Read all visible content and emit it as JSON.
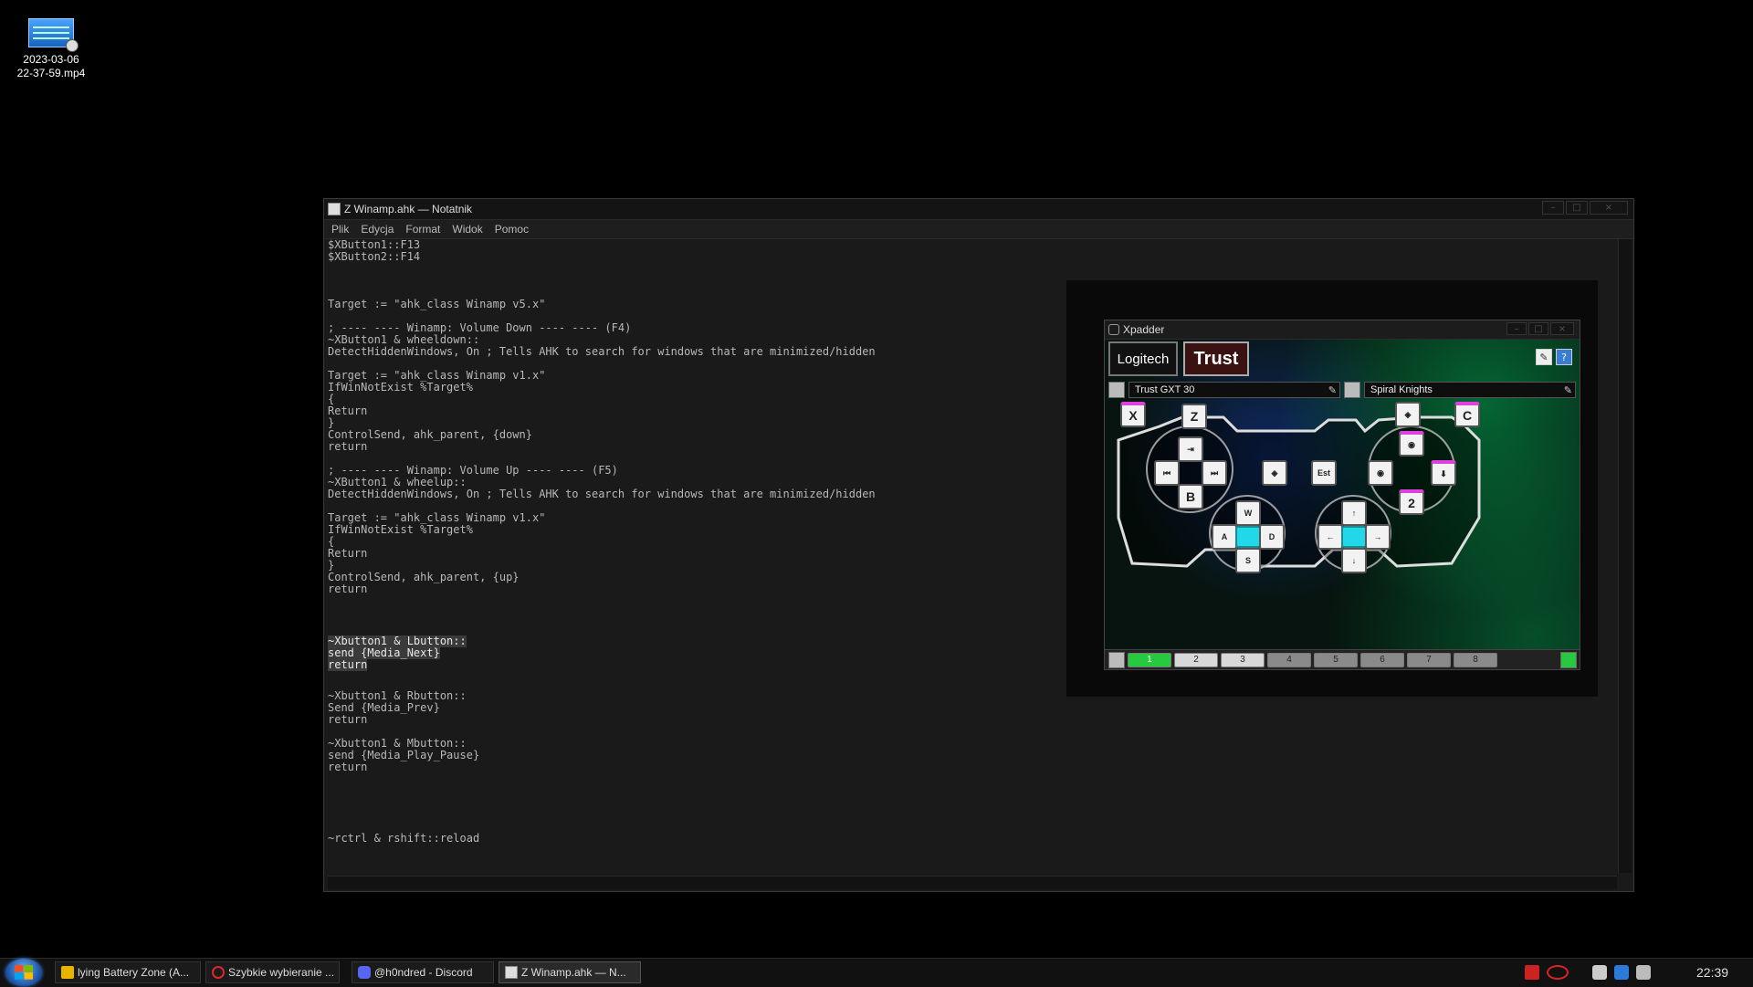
{
  "desktop": {
    "icons": [
      {
        "label_line1": "2023-03-06",
        "label_line2": "22-37-59.mp4",
        "icon": "video-file-icon"
      }
    ]
  },
  "notepad": {
    "title": "Z Winamp.ahk — Notatnik",
    "menu": [
      "Plik",
      "Edycja",
      "Format",
      "Widok",
      "Pomoc"
    ],
    "lines": [
      "$XButton1::F13",
      "$XButton2::F14",
      "",
      "",
      "",
      "Target := \"ahk_class Winamp v5.x\"",
      "",
      "; ---- ---- Winamp: Volume Down ---- ---- (F4)",
      "~XButton1 & wheeldown::",
      "DetectHiddenWindows, On ; Tells AHK to search for windows that are minimized/hidden",
      "",
      "Target := \"ahk_class Winamp v1.x\"",
      "IfWinNotExist %Target%",
      "{",
      "Return",
      "}",
      "ControlSend, ahk_parent, {down}",
      "return",
      "",
      "; ---- ---- Winamp: Volume Up ---- ---- (F5)",
      "~XButton1 & wheelup::",
      "DetectHiddenWindows, On ; Tells AHK to search for windows that are minimized/hidden",
      "",
      "Target := \"ahk_class Winamp v1.x\"",
      "IfWinNotExist %Target%",
      "{",
      "Return",
      "}",
      "ControlSend, ahk_parent, {up}",
      "return",
      "",
      "",
      "",
      "~Xbutton1 & Lbutton::",
      "send {Media_Next}",
      "return",
      "",
      "",
      "~Xbutton1 & Rbutton::",
      "Send {Media_Prev}",
      "return",
      "",
      "~Xbutton1 & Mbutton::",
      "send {Media_Play_Pause}",
      "return",
      "",
      "",
      "",
      "",
      "",
      "~rctrl & rshift::reload"
    ],
    "selected_lines": [
      33,
      34,
      35
    ]
  },
  "xpadder": {
    "title": "Xpadder",
    "logo_left": "Logitech",
    "logo_right": "Trust",
    "controller": "Trust GXT 30",
    "profile": "Spiral Knights",
    "keys": {
      "x": "X",
      "z": "Z",
      "c": "C",
      "est": "Est",
      "b": "B",
      "two": "2",
      "w": "W",
      "a": "A",
      "s": "S",
      "d": "D"
    },
    "sets": [
      "1",
      "2",
      "3",
      "4",
      "5",
      "6",
      "7",
      "8"
    ],
    "active_set": "1"
  },
  "taskbar": {
    "items": [
      {
        "label": "lying Battery Zone (A...",
        "icon": "ahk-icon",
        "active": false
      },
      {
        "label": "Szybkie wybieranie ...",
        "icon": "opera-icon",
        "active": false
      },
      {
        "label": "@h0ndred - Discord",
        "icon": "discord-icon",
        "active": false
      },
      {
        "label": "Z Winamp.ahk — N...",
        "icon": "notepad-icon",
        "active": true
      }
    ],
    "clock": "22:39"
  }
}
